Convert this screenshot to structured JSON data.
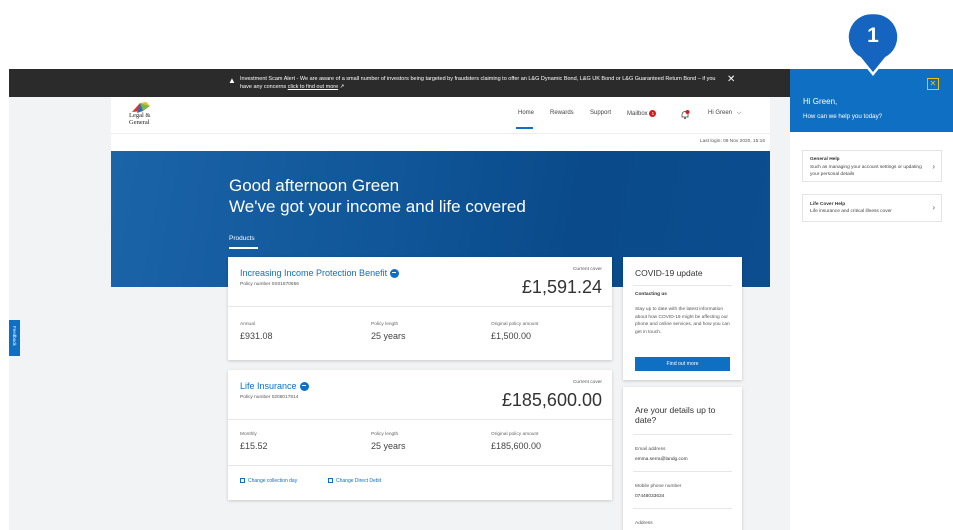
{
  "alert": {
    "message": "Investment Scam Alert - We are aware of a small number of investors being targeted by fraudsters claiming to offer an L&G Dynamic Bond, L&G UK Bond or L&G Guaranteed Return Bond – if you have any concerns",
    "link_text": "click to find out more",
    "close": "✕"
  },
  "header": {
    "logo_line1": "Legal &",
    "logo_line2": "General",
    "nav": [
      "Home",
      "Rewards",
      "Support",
      "Mailbox"
    ],
    "mailbox_count": "1",
    "bell_count": "1",
    "user": "Hi Green",
    "last_login": "Last login: 09 Nov 2020, 15:16"
  },
  "hero": {
    "greeting": "Good afternoon Green",
    "tagline": "We've got your income and life covered",
    "products_tab": "Products"
  },
  "policies": [
    {
      "name": "Increasing Income Protection Benefit",
      "policy_number": "Policy number 0S01870656",
      "current_cover_label": "Current cover",
      "current_cover": "£1,591.24",
      "stats": [
        {
          "label": "Annual",
          "value": "£931.08"
        },
        {
          "label": "Policy length",
          "value": "25 years"
        },
        {
          "label": "Original policy amount",
          "value": "£1,500.00"
        }
      ]
    },
    {
      "name": "Life Insurance",
      "policy_number": "Policy number 0208017814",
      "current_cover_label": "Current cover",
      "current_cover": "£185,600.00",
      "stats": [
        {
          "label": "Monthly",
          "value": "£15.52"
        },
        {
          "label": "Policy length",
          "value": "25 years"
        },
        {
          "label": "Original policy amount",
          "value": "£185,600.00"
        }
      ],
      "links": [
        "Change collection day",
        "Change Direct Debit"
      ]
    }
  ],
  "covid": {
    "title": "COVID-19 update",
    "subtitle": "Contacting us",
    "body": "Stay up to date with the latest information about how COVID-19 might be affecting our phone and online services, and how you can get in touch.",
    "button": "Find out more"
  },
  "details": {
    "title": "Are your details up to date?",
    "email_label": "Email address",
    "email": "emma.serra@landg.com",
    "phone_label": "Mobile phone number",
    "phone": "07448033634",
    "address_label": "Address"
  },
  "feedback": "Feedback",
  "help": {
    "greeting": "Hi Green,",
    "question": "How can we help you today?",
    "close": "✕",
    "items": [
      {
        "title": "General Help",
        "desc": "Such as managing your account settings or updating your personal details"
      },
      {
        "title": "Life Cover Help",
        "desc": "Life insurance and critical illness cover"
      }
    ]
  },
  "callout_number": "1",
  "colors": {
    "accent": "#0e6fc3",
    "hero": "#0f5597",
    "alert_bg": "#2b2b2b",
    "callout": "#1565c0"
  }
}
